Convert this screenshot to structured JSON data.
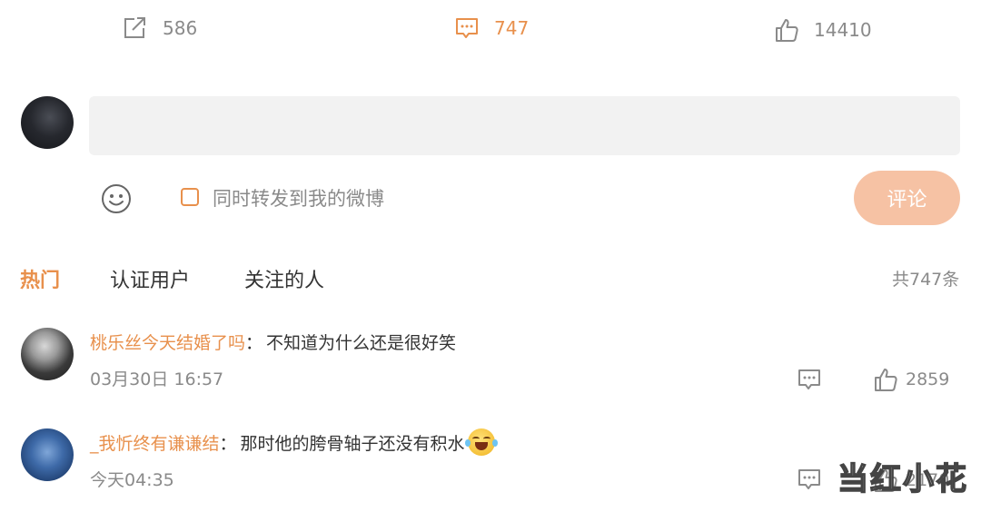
{
  "stats": {
    "repost_count": "586",
    "comment_count": "747",
    "like_count": "14410"
  },
  "composer": {
    "input_value": "",
    "repost_label": "同时转发到我的微博",
    "submit_label": "评论"
  },
  "tabs": {
    "items": [
      "热门",
      "认证用户",
      "关注的人"
    ],
    "active_index": 0,
    "total_label": "共747条"
  },
  "comments": [
    {
      "user": "桃乐丝今天结婚了吗",
      "sep": "：",
      "text": "不知道为什么还是很好笑",
      "time": "03月30日 16:57",
      "likes": "2859",
      "emoji": ""
    },
    {
      "user": "_我忻终有谦谦结",
      "sep": "：",
      "text": "那时他的胯骨轴子还没有积水",
      "time": "今天04:35",
      "likes": "2170",
      "emoji": "laugh-cry-emoji"
    }
  ],
  "watermark": "当红小花",
  "colors": {
    "accent": "#e8904c",
    "muted": "#8a8a8a",
    "button_disabled": "#f6c2a4",
    "input_bg": "#f2f2f2"
  },
  "icons": {
    "repost": "share-icon",
    "comment": "comment-icon",
    "like": "thumbs-up-icon",
    "emoji": "smiley-icon"
  }
}
